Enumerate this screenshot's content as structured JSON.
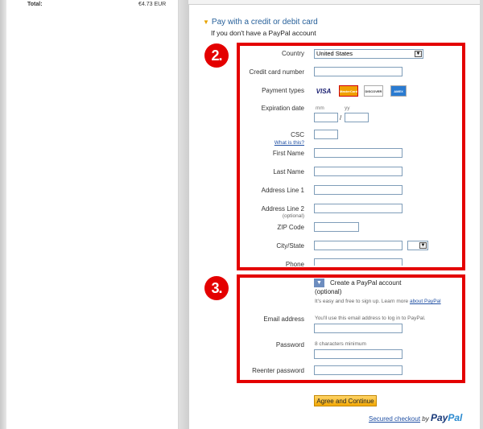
{
  "summary": {
    "total_label": "Total:",
    "total_value": "€4.73 EUR"
  },
  "section": {
    "title": "Pay with a credit or debit card",
    "subtitle": "If you don't have a PayPal account"
  },
  "badges": {
    "step2": "2.",
    "step3": "3."
  },
  "form": {
    "country_label": "Country",
    "country_value": "United States",
    "card_number_label": "Credit card number",
    "payment_types_label": "Payment types",
    "cards": [
      "VISA",
      "MasterCard",
      "DISCOVER",
      "AMEX"
    ],
    "expiration_label": "Expiration date",
    "exp_mm": "mm",
    "exp_yy": "yy",
    "exp_sep": "/",
    "csc_label": "CSC",
    "csc_help": "What is this?",
    "first_name_label": "First Name",
    "last_name_label": "Last Name",
    "address1_label": "Address Line 1",
    "address2_label": "Address Line 2",
    "address2_sub": "(optional)",
    "zip_label": "ZIP Code",
    "citystate_label": "City/State",
    "phone_label": "Phone"
  },
  "account": {
    "create_title": "Create a PayPal account",
    "optional": "(optional)",
    "blurb": "It's easy and free to sign up. Learn more",
    "about_link": "about PayPal",
    "email_label": "Email address",
    "email_hint": "You'll use this email address to log in to PayPal.",
    "password_label": "Password",
    "password_hint": "8 characters minimum",
    "reenter_label": "Reenter password"
  },
  "footer": {
    "continue_button": "Agree and Continue",
    "secured_link": "Secured checkout",
    "by": "by",
    "brand_pay": "Pay",
    "brand_pal": "Pal"
  },
  "colors": {
    "accent_red": "#e40000",
    "link_blue": "#1f4fa3",
    "button_gold": "#f4a800"
  }
}
